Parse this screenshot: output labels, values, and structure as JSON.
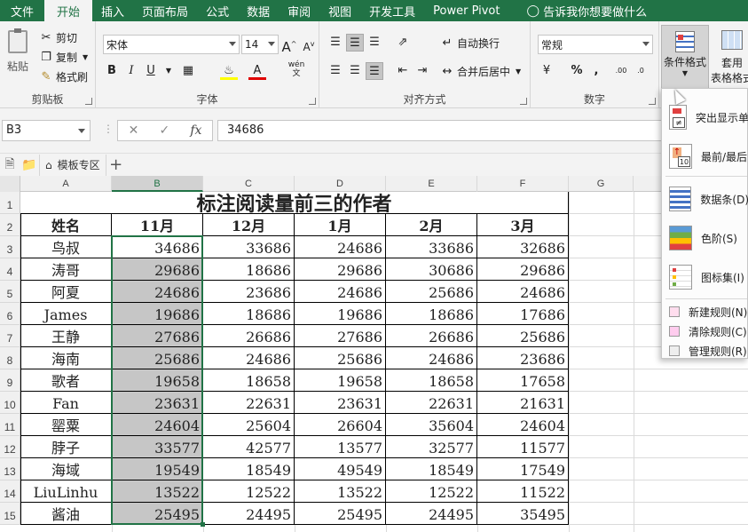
{
  "menu": {
    "tabs": [
      "文件",
      "开始",
      "插入",
      "页面布局",
      "公式",
      "数据",
      "审阅",
      "视图",
      "开发工具",
      "Power Pivot"
    ],
    "active": "开始",
    "tell_me": "告诉我你想要做什么"
  },
  "ribbon": {
    "clipboard": {
      "paste": "粘贴",
      "cut": "剪切",
      "copy": "复制",
      "format_painter": "格式刷",
      "label": "剪贴板"
    },
    "font": {
      "name": "宋体",
      "size": "14",
      "bold": "B",
      "italic": "I",
      "underline": "U",
      "label": "字体",
      "wen": "wén"
    },
    "alignment": {
      "wrap": "自动换行",
      "merge": "合并后居中",
      "label": "对齐方式"
    },
    "number": {
      "format": "常规",
      "percent": "%",
      "comma": ",",
      "label": "数字"
    },
    "styles": {
      "conditional": "条件格式",
      "table_l1": "套用",
      "table_l2": "表格格式"
    }
  },
  "formula_bar": {
    "name_box": "B3",
    "fx": "fx",
    "value": "34686"
  },
  "sheet_tabs": {
    "template": "模板专区"
  },
  "grid": {
    "columns": [
      "A",
      "B",
      "C",
      "D",
      "E",
      "F",
      "G"
    ],
    "selected_column": "B",
    "rows": [
      "1",
      "2",
      "3",
      "4",
      "5",
      "6",
      "7",
      "8",
      "9",
      "10",
      "11",
      "12",
      "13",
      "14",
      "15"
    ],
    "title": "标注阅读量前三的作者",
    "headers": [
      "姓名",
      "11月",
      "12月",
      "1月",
      "2月",
      "3月"
    ],
    "data": [
      [
        "鸟叔",
        "34686",
        "33686",
        "24686",
        "33686",
        "32686"
      ],
      [
        "涛哥",
        "29686",
        "18686",
        "29686",
        "30686",
        "29686"
      ],
      [
        "阿夏",
        "24686",
        "23686",
        "24686",
        "25686",
        "24686"
      ],
      [
        "James",
        "19686",
        "18686",
        "19686",
        "18686",
        "17686"
      ],
      [
        "王静",
        "27686",
        "26686",
        "27686",
        "26686",
        "25686"
      ],
      [
        "海南",
        "25686",
        "24686",
        "25686",
        "24686",
        "23686"
      ],
      [
        "歌者",
        "19658",
        "18658",
        "19658",
        "18658",
        "17658"
      ],
      [
        "Fan",
        "23631",
        "22631",
        "23631",
        "22631",
        "21631"
      ],
      [
        "罂粟",
        "24604",
        "25604",
        "26604",
        "35604",
        "24604"
      ],
      [
        "脖子",
        "33577",
        "42577",
        "13577",
        "32577",
        "11577"
      ],
      [
        "海域",
        "19549",
        "18549",
        "49549",
        "18549",
        "17549"
      ],
      [
        "LiuLinhu",
        "13522",
        "12522",
        "13522",
        "12522",
        "11522"
      ],
      [
        "酱油",
        "25495",
        "24495",
        "25495",
        "24495",
        "35495"
      ]
    ]
  },
  "cf_menu": {
    "items": [
      "突出显示单",
      "最前/最后",
      "数据条(D)",
      "色阶(S)",
      "图标集(I)"
    ],
    "actions": [
      "新建规则(N)",
      "清除规则(C)",
      "管理规则(R)"
    ]
  },
  "colors": {
    "excel_green": "#217346",
    "highlight": "#c6c6c6"
  }
}
